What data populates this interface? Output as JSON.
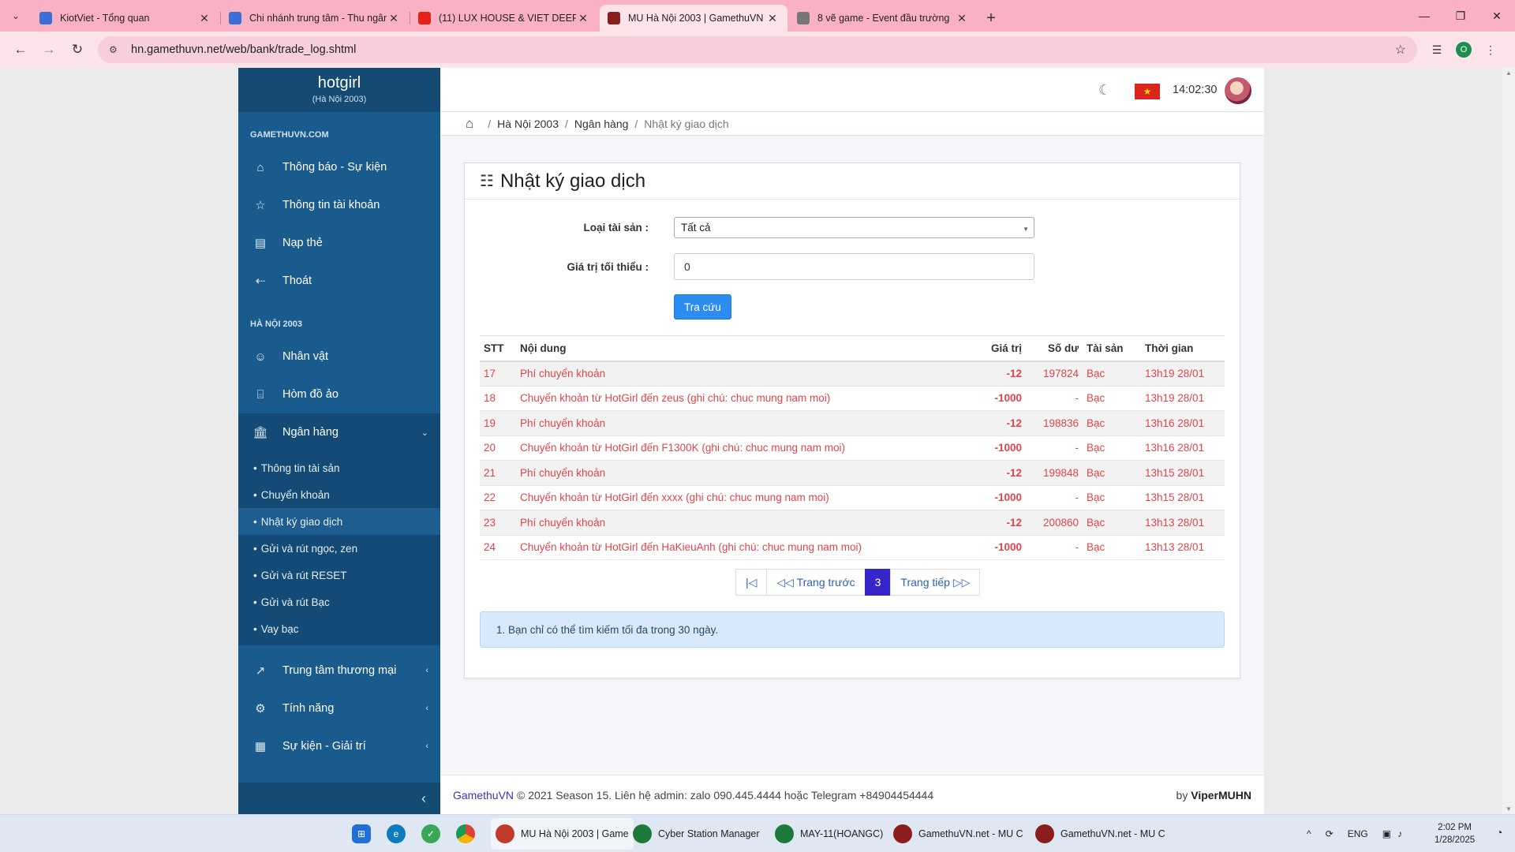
{
  "browser": {
    "tabs": [
      {
        "title": "KiotViet - Tổng quan",
        "color": "#3b6fd8",
        "active": false
      },
      {
        "title": "Chi nhánh trung tâm - Thu ngân",
        "color": "#3b6fd8",
        "active": false
      },
      {
        "title": "(11) LUX HOUSE & VIET DEEP",
        "color": "#e62117",
        "active": false
      },
      {
        "title": "MU Hà Nội 2003 | GamethuVN",
        "color": "#8b1d1d",
        "active": true
      },
      {
        "title": "8 vẽ game - Event đầu trường",
        "color": "#777777",
        "active": false
      }
    ],
    "url": "hn.gamethuvn.net/web/bank/trade_log.shtml",
    "profile_initial": "O"
  },
  "sidebar": {
    "brand_name": "hotgirl",
    "brand_server": "(Hà Nội 2003)",
    "section1": "GAMETHUVN.COM",
    "items1": [
      {
        "label": "Thông báo - Sự kiện",
        "icon": "⌂"
      },
      {
        "label": "Thông tin tài khoản",
        "icon": "☆"
      },
      {
        "label": "Nạp thẻ",
        "icon": "▤"
      },
      {
        "label": "Thoát",
        "icon": "⇠"
      }
    ],
    "section2": "HÀ NỘI 2003",
    "items2": [
      {
        "label": "Nhân vật",
        "icon": "☺"
      },
      {
        "label": "Hòm đồ ảo",
        "icon": "⌸"
      }
    ],
    "bank": {
      "label": "Ngân hàng",
      "icon": "🏛"
    },
    "bank_sub": [
      "Thông tin tài sản",
      "Chuyển khoản",
      "Nhật ký giao dịch",
      "Gửi và rút ngọc, zen",
      "Gửi và rút RESET",
      "Gửi và rút Bạc",
      "Vay bạc"
    ],
    "items3": [
      {
        "label": "Trung tâm thương mại",
        "icon": "↗"
      },
      {
        "label": "Tính năng",
        "icon": "⚙"
      },
      {
        "label": "Sự kiện - Giải trí",
        "icon": "▦"
      }
    ]
  },
  "header": {
    "time": "14:02:30",
    "flag_star": "★"
  },
  "breadcrumb": {
    "server": "Hà Nội 2003",
    "section": "Ngân hàng",
    "current": "Nhật ký giao dịch"
  },
  "card": {
    "title": "Nhật ký giao dịch",
    "asset_label": "Loại tài sản :",
    "asset_value": "Tất cả",
    "min_label": "Giá trị tối thiểu :",
    "min_value": "0",
    "search_button": "Tra cứu"
  },
  "table": {
    "headers": {
      "stt": "STT",
      "content": "Nội dung",
      "value": "Giá trị",
      "balance": "Số dư",
      "asset": "Tài sản",
      "time": "Thời gian"
    },
    "rows": [
      {
        "stt": "17",
        "content": "Phí chuyển khoản",
        "value": "-12",
        "balance": "197824",
        "asset": "Bạc",
        "time": "13h19 28/01"
      },
      {
        "stt": "18",
        "content": "Chuyển khoản từ HotGirl đến zeus (ghi chú: chuc mung nam moi)",
        "value": "-1000",
        "balance": "-",
        "asset": "Bạc",
        "time": "13h19 28/01"
      },
      {
        "stt": "19",
        "content": "Phí chuyển khoản",
        "value": "-12",
        "balance": "198836",
        "asset": "Bạc",
        "time": "13h16 28/01"
      },
      {
        "stt": "20",
        "content": "Chuyển khoản từ HotGirl đến F1300K (ghi chú: chuc mung nam moi)",
        "value": "-1000",
        "balance": "-",
        "asset": "Bạc",
        "time": "13h16 28/01"
      },
      {
        "stt": "21",
        "content": "Phí chuyển khoản",
        "value": "-12",
        "balance": "199848",
        "asset": "Bạc",
        "time": "13h15 28/01"
      },
      {
        "stt": "22",
        "content": "Chuyển khoản từ HotGirl đến xxxx (ghi chú: chuc mung nam moi)",
        "value": "-1000",
        "balance": "-",
        "asset": "Bạc",
        "time": "13h15 28/01"
      },
      {
        "stt": "23",
        "content": "Phí chuyển khoản",
        "value": "-12",
        "balance": "200860",
        "asset": "Bạc",
        "time": "13h13 28/01"
      },
      {
        "stt": "24",
        "content": "Chuyển khoản từ HotGirl đến HaKieuAnh (ghi chú: chuc mung nam moi)",
        "value": "-1000",
        "balance": "-",
        "asset": "Bạc",
        "time": "13h13 28/01"
      }
    ]
  },
  "pager": {
    "first": "|◁",
    "prev": "◁◁ Trang trước",
    "current": "3",
    "next": "Trang tiếp ▷▷"
  },
  "note": "1. Bạn chỉ có thể tìm kiếm tối đa trong 30 ngày.",
  "footer": {
    "brand": "GamethuVN",
    "text": "© 2021 Season 15. Liên hệ admin: zalo 090.445.4444 hoặc Telegram +84904454444",
    "by_prefix": "by",
    "by_name": "ViperMUHN"
  },
  "taskbar": {
    "apps": [
      {
        "label": "MU Hà Nội 2003 | Game",
        "color": "#c0392b"
      },
      {
        "label": "Cyber Station Manager",
        "color": "#1d7a3a"
      },
      {
        "label": "MAY-11(HOANGC)",
        "color": "#1d7a3a"
      },
      {
        "label": "GamethuVN.net - MU C",
        "color": "#8b1d1d"
      },
      {
        "label": "GamethuVN.net - MU C",
        "color": "#8b1d1d"
      }
    ],
    "lang": "ENG",
    "time": "2:02 PM",
    "date": "1/28/2025"
  }
}
